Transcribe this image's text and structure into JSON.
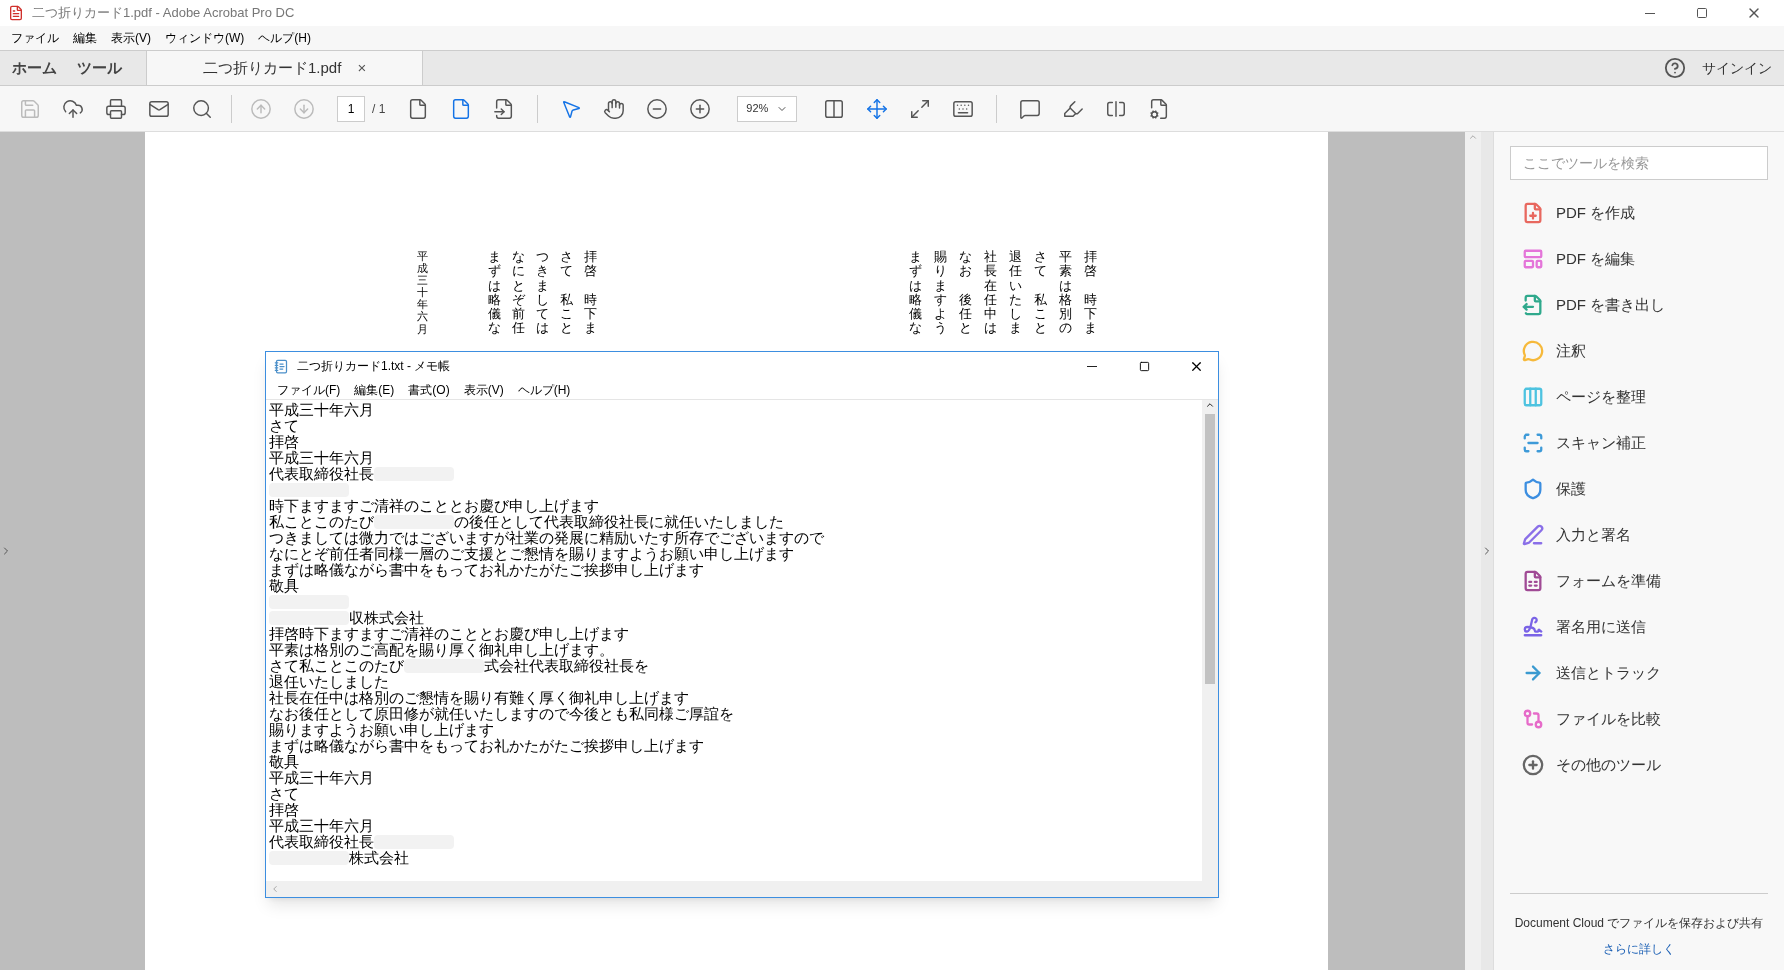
{
  "window": {
    "title": "二つ折りカード1.pdf - Adobe Acrobat Pro DC"
  },
  "menu": [
    "ファイル",
    "編集",
    "表示(V)",
    "ウィンドウ(W)",
    "ヘルプ(H)"
  ],
  "tabs": [
    {
      "label": "ホーム",
      "selected": false
    },
    {
      "label": "ツール",
      "selected": false
    }
  ],
  "document_tab": {
    "label": "二つ折りカード1.pdf",
    "close": "×",
    "selected": true
  },
  "sign_in": "サインイン",
  "toolbar": {
    "page": "1",
    "page_total": "/ 1",
    "zoom": "92%"
  },
  "pdf": {
    "right_columns": [
      [
        "まずは略儀な"
      ],
      [
        "賜りますよう"
      ],
      [
        "なお",
        "後任と"
      ],
      [
        "社長在任中は"
      ],
      [
        "退任いたしま"
      ],
      [
        "さて",
        "私こと"
      ],
      [
        "平素は格別の"
      ],
      [
        "拝啓",
        "時下ま"
      ]
    ],
    "left_columns": [
      [
        "まずは略儀な"
      ],
      [
        "なにとぞ前任"
      ],
      [
        "つきましては"
      ],
      [
        "さて",
        "私こと"
      ],
      [
        "拝啓",
        "時下ま"
      ]
    ],
    "date_column": "平成三十年六月"
  },
  "notepad": {
    "title": "二つ折りカード1.txt - メモ帳",
    "menu": [
      "ファイル(F)",
      "編集(E)",
      "書式(O)",
      "表示(V)",
      "ヘルプ(H)"
    ],
    "lines": [
      [
        {
          "kind": "text",
          "text": "平成三十年六月"
        }
      ],
      [
        {
          "kind": "text",
          "text": "さて"
        }
      ],
      [
        {
          "kind": "text",
          "text": "拝啓"
        }
      ],
      [
        {
          "kind": "text",
          "text": "平成三十年六月"
        }
      ],
      [
        {
          "kind": "text",
          "text": "代表取締役社長"
        },
        {
          "kind": "blur"
        }
      ],
      [
        {
          "kind": "blur"
        }
      ],
      [
        {
          "kind": "text",
          "text": "時下ますますご清祥のこととお慶び申し上げます"
        }
      ],
      [
        {
          "kind": "text",
          "text": "私ことこのたび"
        },
        {
          "kind": "blur"
        },
        {
          "kind": "text",
          "text": "の後任として代表取締役社長に就任いたしました"
        }
      ],
      [
        {
          "kind": "text",
          "text": "つきましては微力ではございますが社業の発展に精励いたす所存でございますので"
        }
      ],
      [
        {
          "kind": "text",
          "text": "なにとぞ前任者同様一層のご支援とご懇情を賜りますようお願い申し上げます"
        }
      ],
      [
        {
          "kind": "text",
          "text": "まずは略儀ながら書中をもってお礼かたがたご挨拶申し上げます"
        }
      ],
      [
        {
          "kind": "text",
          "text": "敬具"
        }
      ],
      [
        {
          "kind": "blur"
        }
      ],
      [
        {
          "kind": "blur"
        },
        {
          "kind": "text",
          "text": "収株式会社"
        }
      ],
      [
        {
          "kind": "text",
          "text": "拝啓時下ますますご清祥のこととお慶び申し上げます"
        }
      ],
      [
        {
          "kind": "text",
          "text": "平素は格別のご高配を賜り厚く御礼申し上げます。"
        }
      ],
      [
        {
          "kind": "text",
          "text": "さて私ことこのたび"
        },
        {
          "kind": "blur"
        },
        {
          "kind": "text",
          "text": "式会社代表取締役社長を"
        }
      ],
      [
        {
          "kind": "text",
          "text": "退任いたしました"
        }
      ],
      [
        {
          "kind": "text",
          "text": "社長在任中は格別のご懇情を賜り有難く厚く御礼申し上げます"
        }
      ],
      [
        {
          "kind": "text",
          "text": "なお後任として原田修が就任いたしますので今後とも私同様ご厚誼を"
        }
      ],
      [
        {
          "kind": "text",
          "text": "賜りますようお願い申し上げます"
        }
      ],
      [
        {
          "kind": "text",
          "text": "まずは略儀ながら書中をもってお礼かたがたご挨拶申し上げます"
        }
      ],
      [
        {
          "kind": "text",
          "text": "敬具"
        }
      ],
      [
        {
          "kind": "text",
          "text": "平成三十年六月"
        }
      ],
      [
        {
          "kind": "text",
          "text": "さて"
        }
      ],
      [
        {
          "kind": "text",
          "text": "拝啓"
        }
      ],
      [
        {
          "kind": "text",
          "text": "平成三十年六月"
        }
      ],
      [
        {
          "kind": "text",
          "text": "代表取締役社長"
        },
        {
          "kind": "blur"
        }
      ],
      [
        {
          "kind": "blur"
        },
        {
          "kind": "text",
          "text": "株式会社"
        }
      ]
    ]
  },
  "tools_panel": {
    "search": {
      "placeholder": "ここでツールを検索"
    },
    "tools": [
      {
        "label": "PDF を作成",
        "color": "#e8685f"
      },
      {
        "label": "PDF を編集",
        "color": "#e475d9"
      },
      {
        "label": "PDF を書き出し",
        "color": "#2fa98c"
      },
      {
        "label": "注釈",
        "color": "#f6b93b"
      },
      {
        "label": "ページを整理",
        "color": "#4ec3e0"
      },
      {
        "label": "スキャン補正",
        "color": "#3d9ad8"
      },
      {
        "label": "保護",
        "color": "#3c8ee0"
      },
      {
        "label": "入力と署名",
        "color": "#8a6fe8"
      },
      {
        "label": "フォームを準備",
        "color": "#a04a95"
      },
      {
        "label": "署名用に送信",
        "color": "#7a63e6"
      },
      {
        "label": "送信とトラック",
        "color": "#3a9ad0"
      },
      {
        "label": "ファイルを比較",
        "color": "#e66bc9"
      },
      {
        "label": "その他のツール",
        "color": "#666666"
      }
    ],
    "footer": "Document Cloud でファイルを保存および共有",
    "link": "さらに詳しく"
  }
}
